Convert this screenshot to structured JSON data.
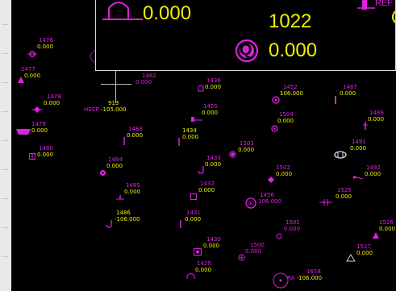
{
  "colors": {
    "background": "#000000",
    "point_id": "#e020e0",
    "value": "#f0f000",
    "ruler": "#e9e9e9"
  },
  "zoom": {
    "left_value": "0.000",
    "count": "1022",
    "q_letter": "Q",
    "q_value": "0.000",
    "ref_label": "REF"
  },
  "points": [
    {
      "id": "1476",
      "val": "0.000",
      "icon": "circle-target-icon"
    },
    {
      "id": "1477",
      "val": "0.000",
      "icon": "triangle-icon"
    },
    {
      "id": "1478",
      "val": "0.000",
      "icon": "diamond-target-icon"
    },
    {
      "id": "1479",
      "val": "0.000",
      "icon": "trapezoid-icon"
    },
    {
      "id": "1480",
      "val": "0.000",
      "icon": "square-grid-icon"
    },
    {
      "id": "1482",
      "val": "0.000",
      "icon": "crosshair-icon"
    },
    {
      "id": "913",
      "val": "-105.000",
      "prefix": "HECP",
      "icon": "arrow-icon"
    },
    {
      "id": "1436",
      "val": "0.000",
      "icon": "bell-icon"
    },
    {
      "id": "1452",
      "val": "106.000",
      "icon": "q-circle-icon"
    },
    {
      "id": "1487",
      "val": "0.000",
      "icon": "valve-icon"
    },
    {
      "id": "1455",
      "val": "0.000",
      "icon": "pipe-icon"
    },
    {
      "id": "1504",
      "val": "0.000",
      "icon": "q-circle-icon"
    },
    {
      "id": "1489",
      "val": "0.000",
      "icon": "valve-icon"
    },
    {
      "id": "1483",
      "val": "0.000",
      "icon": "valve-icon"
    },
    {
      "id": "1434",
      "val": "0.000",
      "icon": "valve-icon"
    },
    {
      "id": "1503",
      "val": "0.000",
      "icon": "filled-dot-icon"
    },
    {
      "id": "1491",
      "val": "0.000",
      "icon": "meter-icon"
    },
    {
      "id": "1484",
      "val": "0.000",
      "icon": "gear-icon"
    },
    {
      "id": "1433",
      "val": "0.000",
      "icon": "hook-icon"
    },
    {
      "id": "1502",
      "val": "0.000",
      "icon": "diamond-icon"
    },
    {
      "id": "1492",
      "val": "0.000",
      "icon": "arrow-icon"
    },
    {
      "id": "1485",
      "val": "0.000",
      "icon": "tee-icon"
    },
    {
      "id": "1432",
      "val": "0.000",
      "icon": "square-icon"
    },
    {
      "id": "1456",
      "val": "106.000",
      "icon": "uc-circle-icon"
    },
    {
      "id": "1525",
      "val": "0.000",
      "icon": "coupling-icon"
    },
    {
      "id": "1486",
      "val": "-106.000",
      "icon": "hook-icon"
    },
    {
      "id": "1431",
      "val": "0.000",
      "icon": "valve-icon"
    },
    {
      "id": "1501",
      "val": "0.000",
      "icon": "ring-icon"
    },
    {
      "id": "1526",
      "val": "0.000",
      "icon": "triangle-icon"
    },
    {
      "id": "1430",
      "val": "0.000",
      "icon": "square-circle-icon"
    },
    {
      "id": "1500",
      "val": "0.000",
      "icon": "ring-dot-icon"
    },
    {
      "id": "1527",
      "val": "0.000",
      "icon": "triangle-outline-icon"
    },
    {
      "id": "1429",
      "val": "0.000",
      "icon": "lamp-icon"
    },
    {
      "id": "1658",
      "val": "-106.000",
      "prefix": "RA",
      "icon": "ring-icon"
    }
  ]
}
